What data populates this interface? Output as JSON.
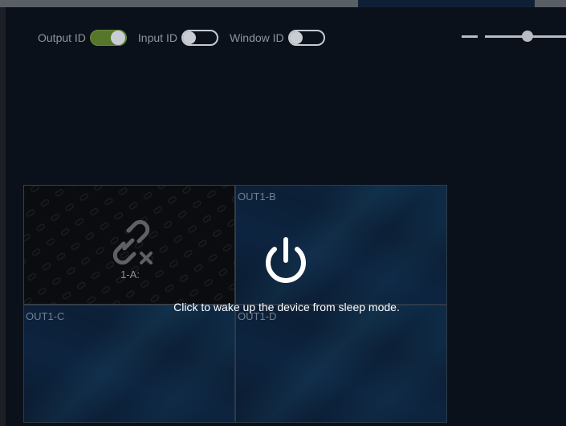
{
  "toggles": [
    {
      "label": "Output ID",
      "state": "on"
    },
    {
      "label": "Input ID",
      "state": "off"
    },
    {
      "label": "Window ID",
      "state": "off"
    }
  ],
  "zoom": {
    "level_fraction": 0.45
  },
  "grid": {
    "cells": [
      {
        "label": "1-A:",
        "status": "disconnected",
        "icon": "broken-link-icon"
      },
      {
        "label": "OUT1-B"
      },
      {
        "label": "OUT1-C"
      },
      {
        "label": "OUT1-D"
      }
    ]
  },
  "overlay": {
    "icon": "power-icon",
    "message": "Click to wake up the device from sleep mode."
  },
  "colors": {
    "background": "#0b111a",
    "toggle_on": "#56772b",
    "toggle_off_border": "#c7cbd1",
    "label_text": "#8f949b",
    "output_cell": "#0d2440",
    "overlay_text": "#ffffff"
  }
}
